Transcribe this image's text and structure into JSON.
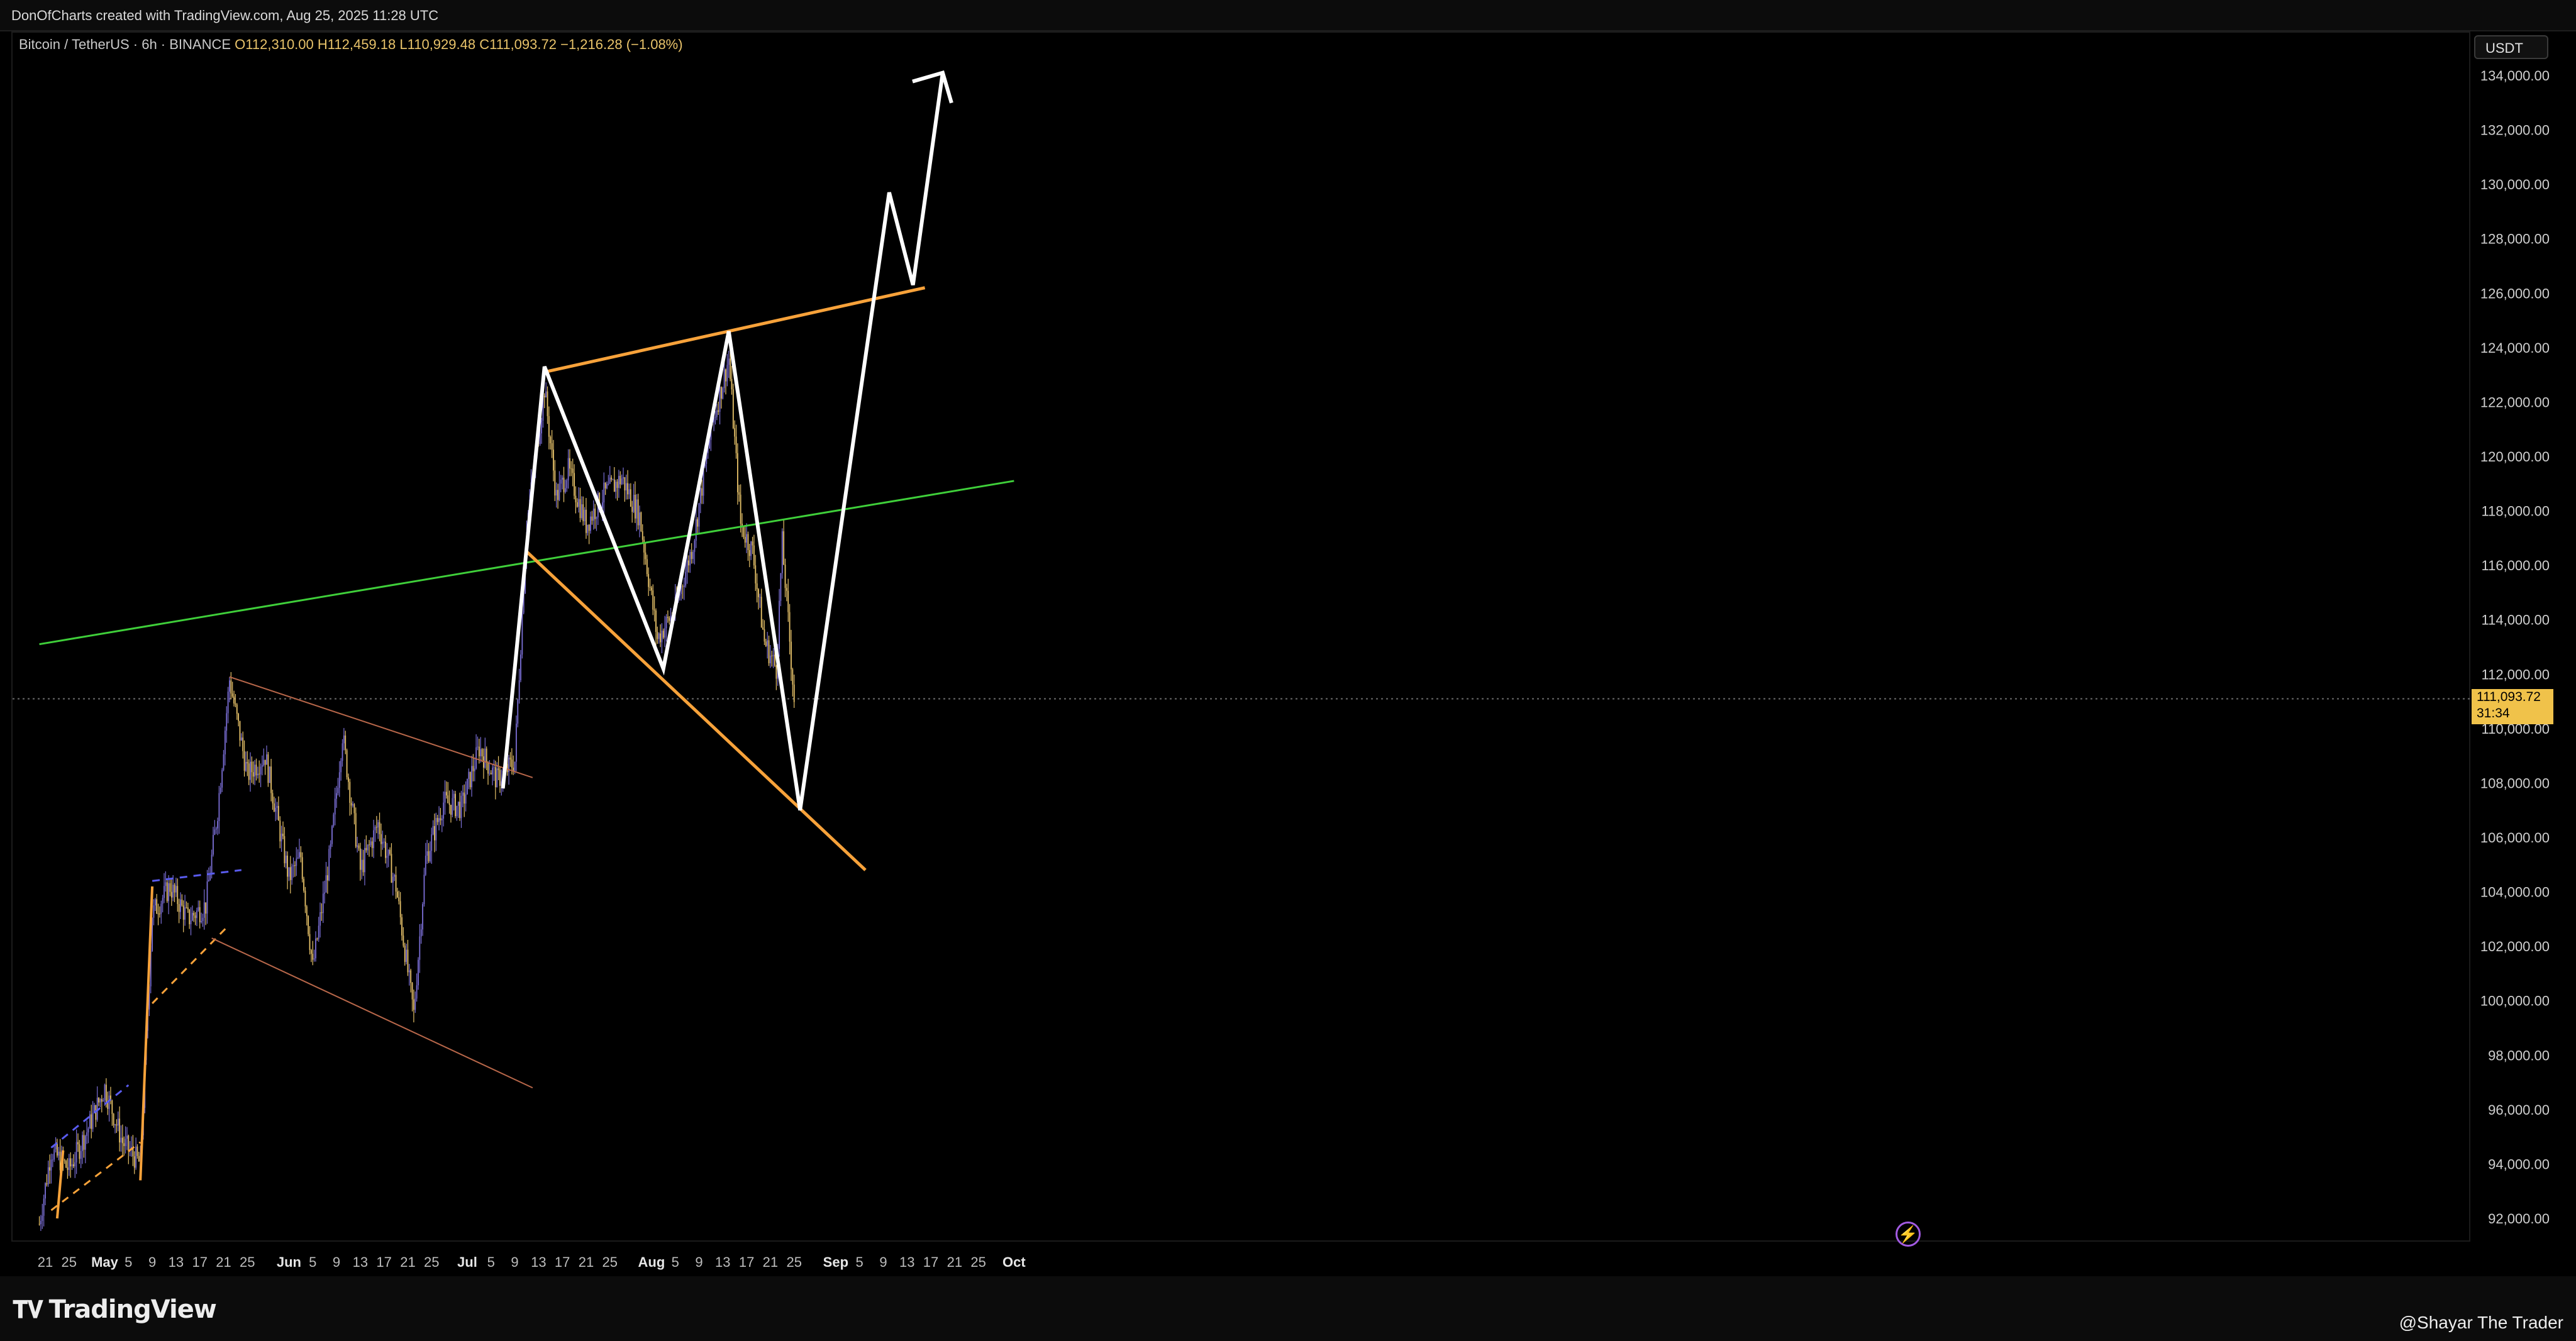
{
  "header": {
    "created_text": "DonOfCharts created with TradingView.com, Aug 25, 2025 11:28 UTC"
  },
  "legend": {
    "symbol": "Bitcoin / TetherUS · 6h · BINANCE",
    "open": "O112,310.00",
    "high": "H112,459.18",
    "low": "L110,929.48",
    "close": "C111,093.72",
    "change": "−1,216.28 (−1.08%)"
  },
  "price_scale": {
    "currency": "USDT",
    "last_price": "111,093.72",
    "countdown": "31:34",
    "ticks": [
      "134,000.00",
      "132,000.00",
      "130,000.00",
      "128,000.00",
      "126,000.00",
      "124,000.00",
      "122,000.00",
      "120,000.00",
      "118,000.00",
      "116,000.00",
      "114,000.00",
      "112,000.00",
      "110,000.00",
      "108,000.00",
      "106,000.00",
      "104,000.00",
      "102,000.00",
      "100,000.00",
      "98,000.00",
      "96,000.00",
      "94,000.00",
      "92,000.00"
    ]
  },
  "footer": {
    "brand": "TradingView",
    "author": "@Shayar The Trader"
  },
  "colors": {
    "candle_up": "#7b6fd6",
    "candle_down": "#e8c36a",
    "trend_green": "#3fcf3a",
    "channel_orange": "#f7a23a",
    "projection_white": "#ffffff",
    "dashed_blue": "#5a5cf0"
  },
  "chart_data": {
    "type": "candlestick",
    "title": "Bitcoin / TetherUS · 6h · BINANCE",
    "x_tick_labels": [
      "21",
      "25",
      "May",
      "5",
      "9",
      "13",
      "17",
      "21",
      "25",
      "Jun",
      "5",
      "9",
      "13",
      "17",
      "21",
      "25",
      "Jul",
      "5",
      "9",
      "13",
      "17",
      "21",
      "25",
      "Aug",
      "5",
      "9",
      "13",
      "17",
      "21",
      "25",
      "Sep",
      "5",
      "9",
      "13",
      "17",
      "21",
      "25",
      "Oct"
    ],
    "ylim": [
      91000,
      135000
    ],
    "last_close": 111093.72,
    "price_path": [
      [
        "2025-04-20",
        91800
      ],
      [
        "2025-04-22",
        94500
      ],
      [
        "2025-04-25",
        93800
      ],
      [
        "2025-04-28",
        95200
      ],
      [
        "2025-05-01",
        96800
      ],
      [
        "2025-05-04",
        94800
      ],
      [
        "2025-05-07",
        94000
      ],
      [
        "2025-05-09",
        103200
      ],
      [
        "2025-05-12",
        104200
      ],
      [
        "2025-05-15",
        103000
      ],
      [
        "2025-05-18",
        103500
      ],
      [
        "2025-05-20",
        107000
      ],
      [
        "2025-05-22",
        111800
      ],
      [
        "2025-05-25",
        108300
      ],
      [
        "2025-05-28",
        109000
      ],
      [
        "2025-06-01",
        104500
      ],
      [
        "2025-06-03",
        105300
      ],
      [
        "2025-06-05",
        101200
      ],
      [
        "2025-06-08",
        105500
      ],
      [
        "2025-06-10",
        109800
      ],
      [
        "2025-06-13",
        104800
      ],
      [
        "2025-06-16",
        106500
      ],
      [
        "2025-06-19",
        104200
      ],
      [
        "2025-06-22",
        99500
      ],
      [
        "2025-06-24",
        105200
      ],
      [
        "2025-06-27",
        107300
      ],
      [
        "2025-06-30",
        107100
      ],
      [
        "2025-07-03",
        109300
      ],
      [
        "2025-07-06",
        108100
      ],
      [
        "2025-07-09",
        108800
      ],
      [
        "2025-07-11",
        117500
      ],
      [
        "2025-07-14",
        122500
      ],
      [
        "2025-07-16",
        118500
      ],
      [
        "2025-07-18",
        119500
      ],
      [
        "2025-07-21",
        117500
      ],
      [
        "2025-07-24",
        118600
      ],
      [
        "2025-07-27",
        119200
      ],
      [
        "2025-07-30",
        117800
      ],
      [
        "2025-08-02",
        113300
      ],
      [
        "2025-08-05",
        114400
      ],
      [
        "2025-08-08",
        116800
      ],
      [
        "2025-08-11",
        121000
      ],
      [
        "2025-08-14",
        123600
      ],
      [
        "2025-08-16",
        117500
      ],
      [
        "2025-08-18",
        116500
      ],
      [
        "2025-08-20",
        113200
      ],
      [
        "2025-08-22",
        112200
      ],
      [
        "2025-08-23",
        116800
      ],
      [
        "2025-08-25",
        111093
      ]
    ],
    "drawings": [
      {
        "name": "green-trendline",
        "color": "green",
        "points": [
          [
            "2025-04-20",
            113100
          ],
          [
            "2025-10-01",
            119100
          ]
        ]
      },
      {
        "name": "orange-upper-channel",
        "color": "orange",
        "points": [
          [
            "2025-07-14",
            123100
          ],
          [
            "2025-09-16",
            126200
          ]
        ]
      },
      {
        "name": "orange-lower-channel",
        "color": "orange",
        "points": [
          [
            "2025-07-11",
            116500
          ],
          [
            "2025-09-06",
            104800
          ]
        ]
      },
      {
        "name": "descending-channel-upper",
        "color": "orange-thin",
        "points": [
          [
            "2025-05-22",
            111900
          ],
          [
            "2025-07-12",
            108200
          ]
        ]
      },
      {
        "name": "descending-channel-lower",
        "color": "orange-thin",
        "points": [
          [
            "2025-05-19",
            102300
          ],
          [
            "2025-07-12",
            96800
          ]
        ]
      },
      {
        "name": "white-projection",
        "color": "white",
        "points": [
          [
            "2025-07-07",
            107800
          ],
          [
            "2025-07-14",
            123300
          ],
          [
            "2025-08-03",
            112200
          ],
          [
            "2025-08-14",
            124600
          ],
          [
            "2025-08-26",
            107000
          ],
          [
            "2025-09-10",
            129700
          ],
          [
            "2025-09-14",
            126300
          ],
          [
            "2025-09-19",
            134100
          ]
        ]
      }
    ]
  }
}
